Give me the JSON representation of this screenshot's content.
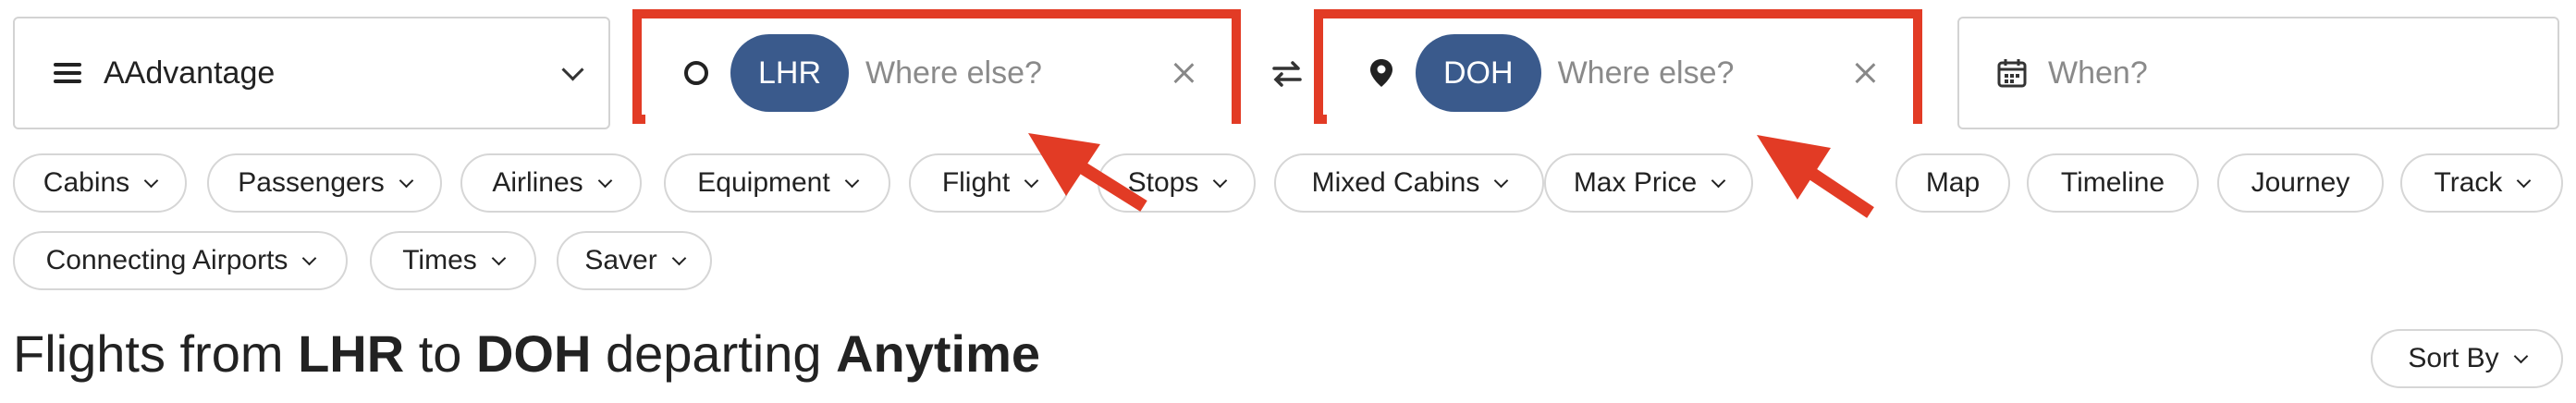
{
  "program": {
    "label": "AAdvantage"
  },
  "origin": {
    "code": "LHR",
    "placeholder": "Where else?"
  },
  "destination": {
    "code": "DOH",
    "placeholder": "Where else?"
  },
  "when": {
    "placeholder": "When?"
  },
  "filters": {
    "row1": [
      "Cabins",
      "Passengers",
      "Airlines",
      "Equipment",
      "Flight",
      "Stops",
      "Mixed Cabins",
      "Max Price"
    ],
    "views": [
      "Map",
      "Timeline",
      "Journey",
      "Track"
    ],
    "row2": [
      "Connecting Airports",
      "Times",
      "Saver"
    ]
  },
  "heading": {
    "p1": "Flights from ",
    "origin": "LHR",
    "p2": " to ",
    "dest": "DOH",
    "p3": " departing ",
    "when": "Anytime"
  },
  "sort": {
    "label": "Sort By"
  },
  "colors": {
    "chip": "#3a5a8c",
    "annotation": "#e23b25"
  }
}
